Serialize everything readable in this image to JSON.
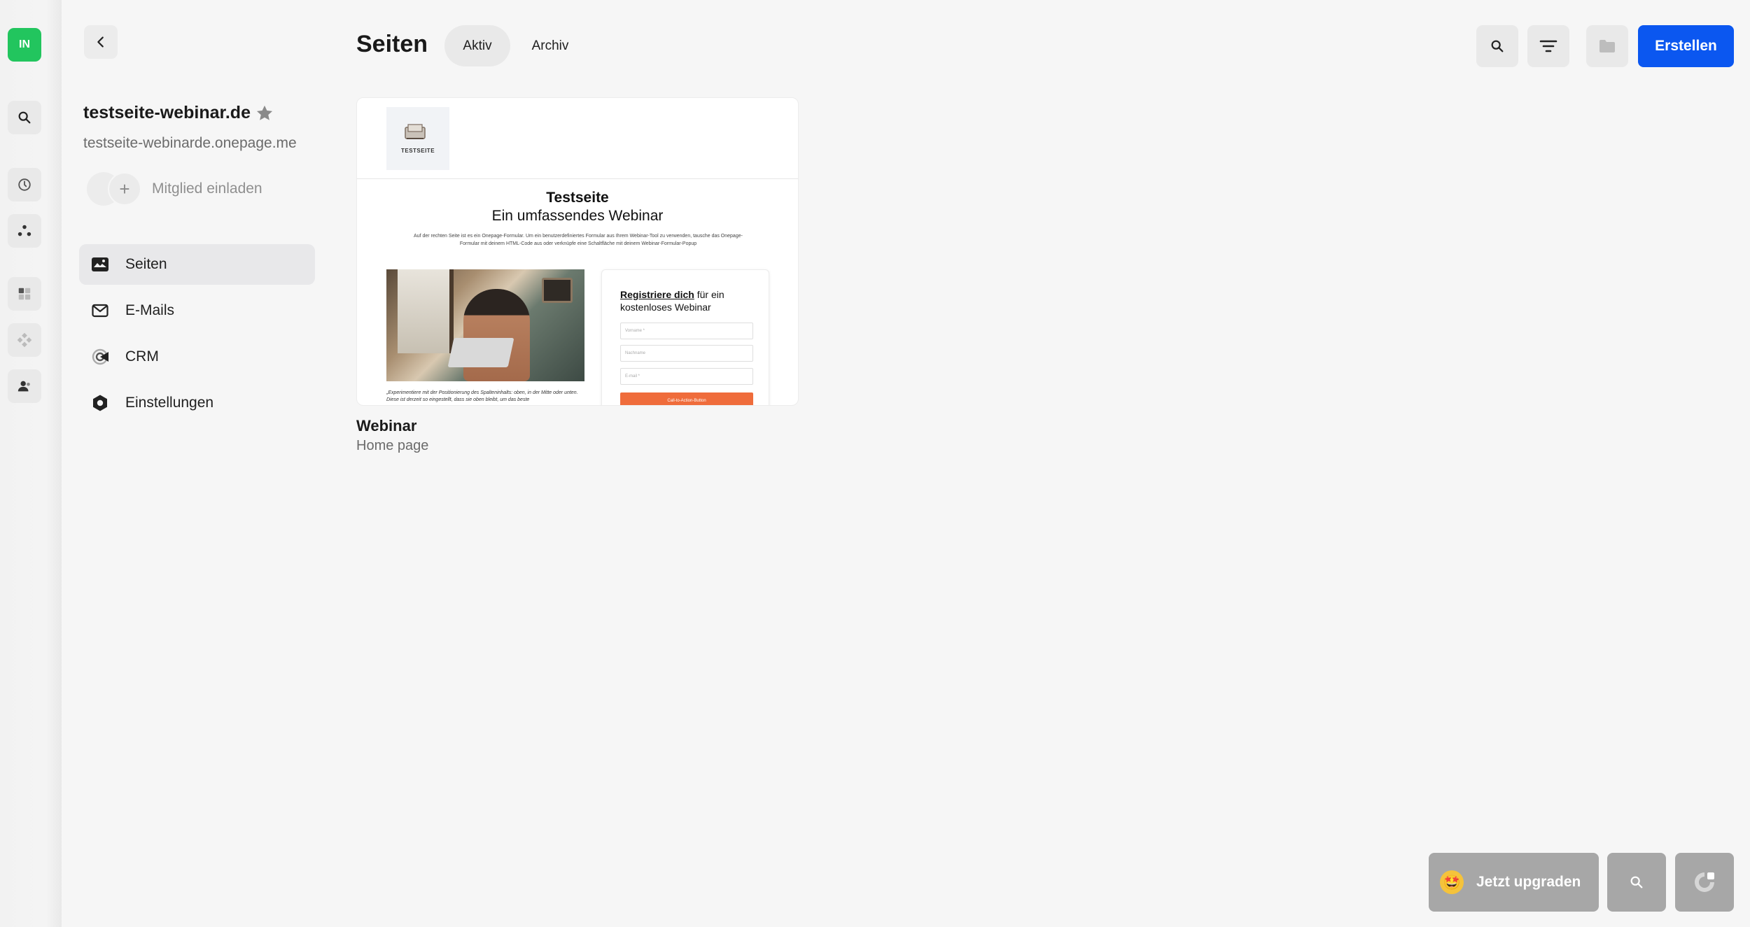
{
  "rail": {
    "avatar_initials": "IN",
    "icons": [
      "search-icon",
      "history-icon",
      "nodes-icon",
      "dashboard-icon",
      "integrations-icon",
      "people-icon"
    ]
  },
  "panel": {
    "project_title": "testseite-webinar.de",
    "project_url": "testseite-webinarde.onepage.me",
    "invite_label": "Mitglied einladen",
    "nav": [
      {
        "label": "Seiten",
        "icon": "pages-icon",
        "active": true
      },
      {
        "label": "E-Mails",
        "icon": "mail-icon",
        "active": false
      },
      {
        "label": "CRM",
        "icon": "crm-icon",
        "active": false
      },
      {
        "label": "Einstellungen",
        "icon": "settings-icon",
        "active": false
      }
    ]
  },
  "header": {
    "title": "Seiten",
    "tabs": [
      {
        "label": "Aktiv",
        "active": true
      },
      {
        "label": "Archiv",
        "active": false
      }
    ],
    "create_label": "Erstellen"
  },
  "card": {
    "title": "Webinar",
    "subtitle": "Home page",
    "preview": {
      "logo_text": "TESTSEITE",
      "heading": "Testseite",
      "subheading": "Ein umfassendes Webinar",
      "description": "Auf der rechten Seite ist es ein Onepage-Formular. Um ein benutzerdefiniertes Formular aus Ihrem Webinar-Tool zu verwenden, tausche das Onepage-Formular mit deinem HTML-Code aus oder verknüpfe eine Schaltfläche mit deinem Webinar-Formular-Popup",
      "quote": "„Experimentiere mit der Positionierung des Spalteninhalts: oben, in der Mitte oder unten. Diese ist derzeit so eingestellt, dass sie oben bleibt, um das beste",
      "form_title_bold": "Registriere dich",
      "form_title_rest": " für ein kostenloses Webinar",
      "field_first": "Vorname *",
      "field_last": "Nachname",
      "field_email": "E-mail *",
      "submit": "Call-to-Action-Button"
    }
  },
  "bottom": {
    "upgrade_label": "Jetzt upgraden",
    "upgrade_emoji": "🤩"
  },
  "colors": {
    "accent": "#0b57f0",
    "avatar": "#22c55e",
    "cta_orange": "#ef6c3b"
  }
}
